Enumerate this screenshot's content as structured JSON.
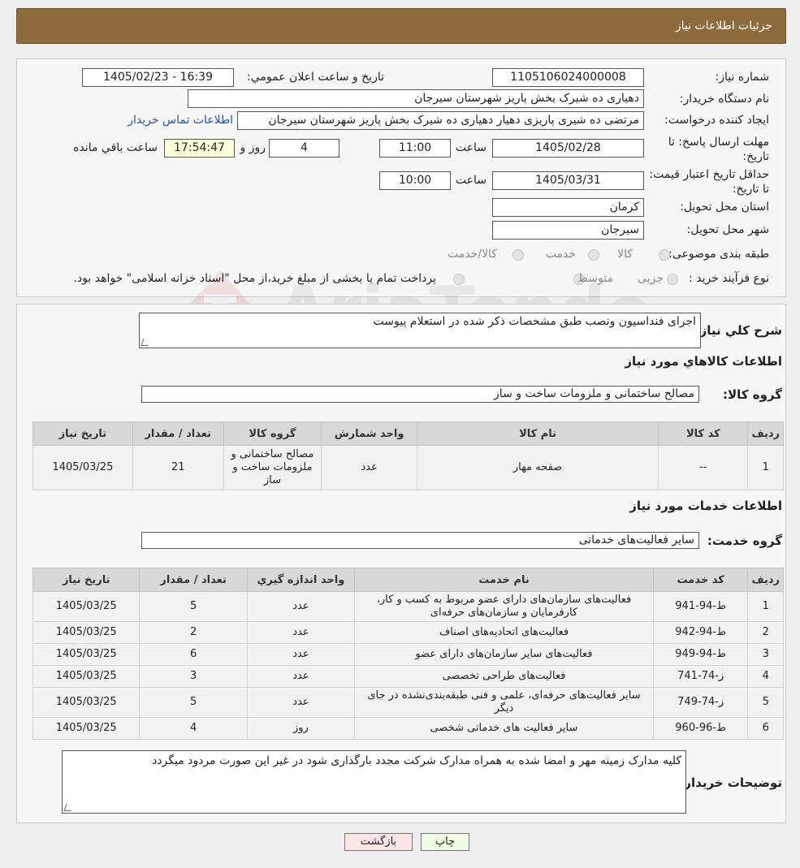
{
  "header": {
    "title": "جزئیات اطلاعات نیاز"
  },
  "watermark": {
    "text": "AriaTender.neT"
  },
  "info": {
    "need_number_label": "شماره نیاز:",
    "need_number": "1105106024000008",
    "announce_label": "تاریخ و ساعت اعلان عمومي:",
    "announce_value": "1405/02/23 - 16:39",
    "buyer_org_label": "نام دستگاه خريدار:",
    "buyer_org": "دهیاری ده شیرک بخش پاریز شهرستان سیرجان",
    "creator_label": "ايجاد کننده درخواست:",
    "creator": "مرتضی ده شیری پاریزی دهیار دهیاری ده شیرک بخش پاریز شهرستان سیرجان",
    "contact_link": "اطلاعات تماس خریدار",
    "deadline_label": "مهلت ارسال پاسخ: تا تاریخ:",
    "deadline_date": "1405/02/28",
    "time_label": "ساعت",
    "deadline_time": "11:00",
    "days_value": "4",
    "days_label": "روز و",
    "remaining_time": "17:54:47",
    "remaining_label": "ساعت باقي مانده",
    "validity_label": "حداقل تاریخ اعتبار قیمت: تا تاریخ:",
    "validity_date": "1405/03/31",
    "validity_time": "10:00",
    "province_label": "استان محل تحویل:",
    "province": "کرمان",
    "city_label": "شهر محل تحویل:",
    "city": "سیرجان",
    "category_label": "طبقه بندی موضوعی:",
    "category_options": [
      "کالا",
      "خدمت",
      "کالا/خدمت"
    ],
    "process_label": "نوع فرآیند خرید :",
    "process_options": [
      "جزیی",
      "متوسط"
    ],
    "process_note": "پرداخت تمام یا بخشی از مبلغ خرید،از محل \"اسناد خزانه اسلامی\" خواهد بود."
  },
  "details": {
    "summary_label": "شرح کلي نياز:",
    "summary": "اجرای فنداسیون ونصب طبق مشخصات ذکر شده در استعلام پیوست",
    "goods_title": "اطلاعات کالاهاي مورد نياز",
    "goods_group_label": "گروه کالا:",
    "goods_group": "مصالح ساختمانی و ملزومات ساخت و ساز",
    "goods_headers": [
      "رديف",
      "کد کالا",
      "نام کالا",
      "واحد شمارش",
      "گروه کالا",
      "تعداد / مقدار",
      "تاريخ نياز"
    ],
    "goods_rows": [
      [
        "1",
        "--",
        "صفحه مهار",
        "عدد",
        "مصالح ساختمانی و ملزومات ساخت و ساز",
        "21",
        "1405/03/25"
      ]
    ],
    "services_title": "اطلاعات خدمات مورد نياز",
    "service_group_label": "گروه خدمت:",
    "service_group": "سایر فعالیت‌های خدماتی",
    "services_headers": [
      "رديف",
      "کد خدمت",
      "نام خدمت",
      "واحد اندازه گيري",
      "تعداد / مقدار",
      "تاريخ نياز"
    ],
    "services_rows": [
      [
        "1",
        "ط-94-941",
        "فعالیت‌های سازمان‌های دارای عضو مربوط به کسب و کار، کارفرمایان و سازمان‌های حرفه‌ای",
        "عدد",
        "5",
        "1405/03/25"
      ],
      [
        "2",
        "ط-94-942",
        "فعالیت‌های اتحادیه‌های اصناف",
        "عدد",
        "2",
        "1405/03/25"
      ],
      [
        "3",
        "ط-94-949",
        "فعالیت‌های سایر سازمان‌های دارای عضو",
        "عدد",
        "6",
        "1405/03/25"
      ],
      [
        "4",
        "ز-74-741",
        "فعالیت‌های طراحی تخصصی",
        "عدد",
        "3",
        "1405/03/25"
      ],
      [
        "5",
        "ز-74-749",
        "سایر فعالیت‌های حرفه‌ای، علمی و فنی طبقه‌بندی‌نشده در جای دیگر",
        "عدد",
        "5",
        "1405/03/25"
      ],
      [
        "6",
        "ط-96-960",
        "سایر فعالیت های خدماتی شخصی",
        "روز",
        "4",
        "1405/03/25"
      ]
    ],
    "buyer_notes_label": "توضيحات خريدار:",
    "buyer_notes": "کلیه مدارک زمینه مهر و امضا شده به همراه مدارک شرکت مجدد بارگذاری شود در غیر این صورت مردود میگردد"
  },
  "buttons": {
    "print": "چاپ",
    "back": "بازگشت"
  }
}
